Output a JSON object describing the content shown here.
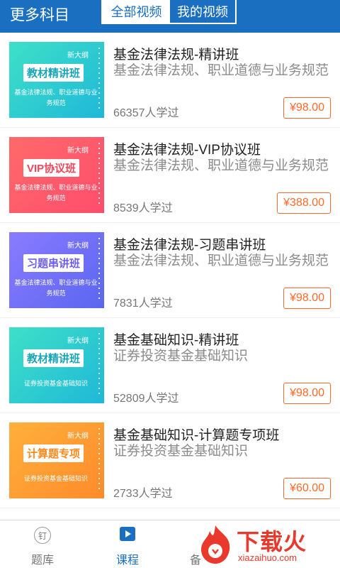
{
  "header": {
    "title": "更多科目",
    "tabs": [
      {
        "label": "全部视频",
        "active": true
      },
      {
        "label": "我的视频",
        "active": false
      }
    ]
  },
  "courses": [
    {
      "thumb": {
        "tag": "新大纲",
        "badge": "教材精讲班",
        "sub": "基金法律法规、职业道德与业务规范",
        "color": "teal"
      },
      "title": "基金法律法规-精讲班",
      "desc": "基金法律法规、职业道德与业务规范",
      "learners": "66357人学过",
      "price": "¥98.00"
    },
    {
      "thumb": {
        "tag": "新大纲",
        "badge": "VIP协议班",
        "sub": "基金法律法规、职业道德与业务规范",
        "color": "red"
      },
      "title": "基金法律法规-VIP协议班",
      "desc": "基金法律法规、职业道德与业务规范",
      "learners": "8539人学过",
      "price": "¥388.00"
    },
    {
      "thumb": {
        "tag": "新大纲",
        "badge": "习题串讲班",
        "sub": "基金法律法规、职业道德与业务规范",
        "color": "purple"
      },
      "title": "基金法律法规-习题串讲班",
      "desc": "基金法律法规、职业道德与业务规范",
      "learners": "7831人学过",
      "price": "¥98.00"
    },
    {
      "thumb": {
        "tag": "新大纲",
        "badge": "教材精讲班",
        "sub": "证券投资基金基础知识",
        "color": "teal"
      },
      "title": "基金基础知识-精讲班",
      "desc": "证券投资基金基础知识",
      "learners": "52809人学过",
      "price": "¥98.00"
    },
    {
      "thumb": {
        "tag": "新大纲",
        "badge": "计算题专项",
        "sub": "证券投资基金基础知识",
        "color": "orange"
      },
      "title": "基金基础知识-计算题专项班",
      "desc": "证券投资基金基础知识",
      "learners": "2733人学过",
      "price": "¥60.00"
    }
  ],
  "bottom_nav": [
    {
      "label": "题库",
      "icon": "stamp-icon",
      "active": false
    },
    {
      "label": "课程",
      "icon": "play-icon",
      "active": true
    },
    {
      "label": "备",
      "icon": "",
      "active": false
    }
  ],
  "watermark": {
    "text": "下载火",
    "url": "xiazaihuo.com"
  },
  "colors": {
    "primary": "#1a6fc0",
    "price": "#ff6a2a"
  }
}
